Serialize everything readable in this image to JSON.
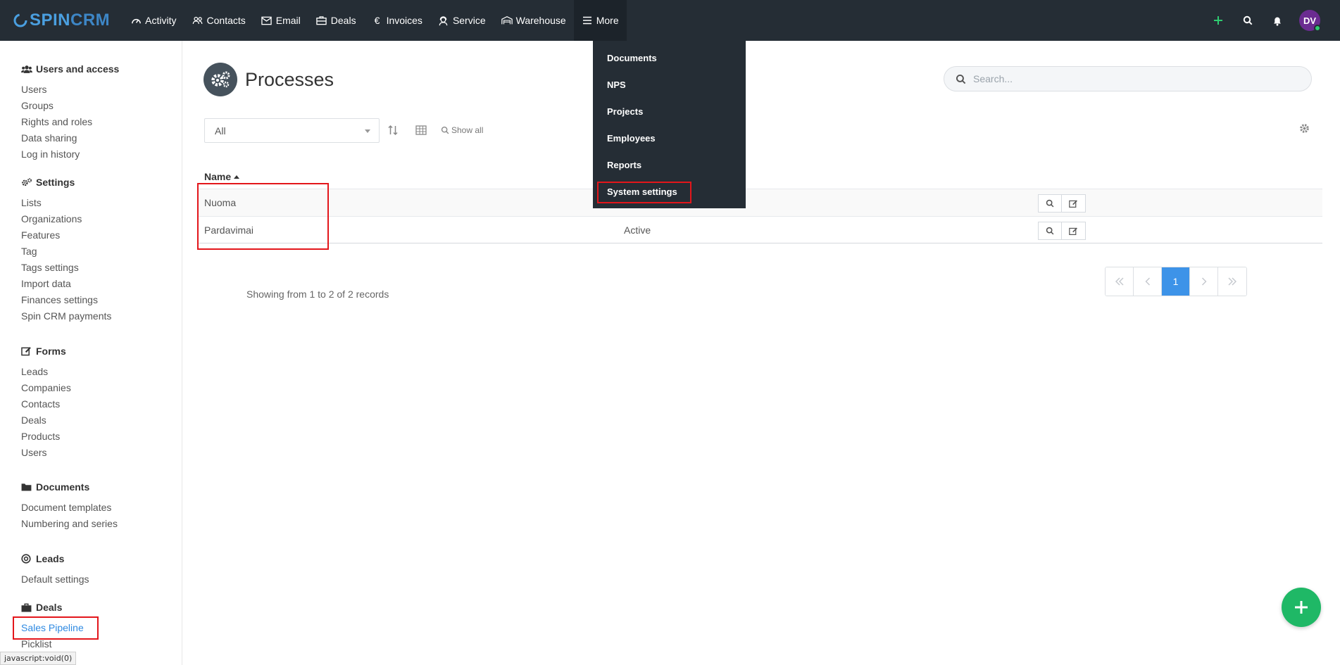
{
  "brand": {
    "logo_part1": "SPIN",
    "logo_part2": "CRM"
  },
  "topnav": {
    "items": [
      {
        "label": "Activity",
        "icon": "gauge-icon"
      },
      {
        "label": "Contacts",
        "icon": "users-icon"
      },
      {
        "label": "Email",
        "icon": "envelope-icon"
      },
      {
        "label": "Deals",
        "icon": "briefcase-icon"
      },
      {
        "label": "Invoices",
        "icon": "euro-icon"
      },
      {
        "label": "Service",
        "icon": "support-icon"
      },
      {
        "label": "Warehouse",
        "icon": "warehouse-icon"
      },
      {
        "label": "More",
        "icon": "hamburger-icon"
      }
    ],
    "user_initials": "DV",
    "add_color": "#2ecc71"
  },
  "more_menu": {
    "items": [
      "Documents",
      "NPS",
      "Projects",
      "Employees",
      "Reports",
      "System settings"
    ]
  },
  "sidebar": {
    "users_access": {
      "title": "Users and access",
      "items": [
        "Users",
        "Groups",
        "Rights and roles",
        "Data sharing",
        "Log in history"
      ]
    },
    "settings": {
      "title": "Settings",
      "items": [
        "Lists",
        "Organizations",
        "Features",
        "Tag",
        "Tags settings",
        "Import data",
        "Finances settings",
        "Spin CRM payments"
      ]
    },
    "forms": {
      "title": "Forms",
      "items": [
        "Leads",
        "Companies",
        "Contacts",
        "Deals",
        "Products",
        "Users"
      ]
    },
    "documents": {
      "title": "Documents",
      "items": [
        "Document templates",
        "Numbering and series"
      ]
    },
    "leads": {
      "title": "Leads",
      "items": [
        "Default settings"
      ]
    },
    "deals": {
      "title": "Deals",
      "items": [
        "Sales Pipeline",
        "Picklist"
      ]
    }
  },
  "main": {
    "title": "Processes",
    "search_placeholder": "Search...",
    "filter_value": "All",
    "show_all": "Show all",
    "column_name": "Name",
    "rows": [
      {
        "name": "Nuoma",
        "status": ""
      },
      {
        "name": "Pardavimai",
        "status": "Active"
      }
    ],
    "records_info": "Showing from 1 to 2 of 2 records",
    "pagination": {
      "current_page": "1"
    }
  },
  "statusbar": {
    "text": "javascript:void(0)"
  },
  "colors": {
    "nav_bg": "#252d35",
    "accent": "#3d93e8",
    "highlight": "#e3161b",
    "fab": "#1fb866"
  }
}
